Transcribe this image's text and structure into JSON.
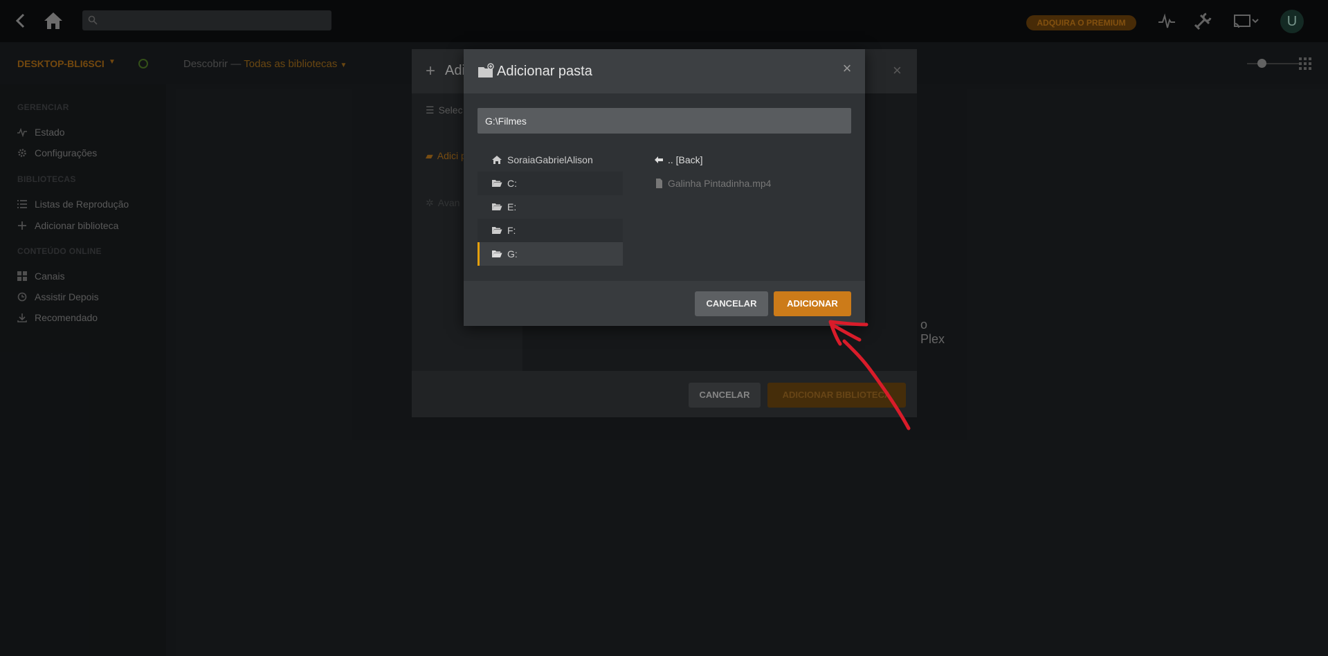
{
  "topbar": {
    "search_placeholder": "",
    "premium_label": "ADQUIRA O PREMIUM",
    "avatar_initial": "U"
  },
  "subbar": {
    "server_name": "DESKTOP-BLI6SCI",
    "crumb_prefix": "Descobrir",
    "crumb_separator": "—",
    "crumb_selected": "Todas as bibliotecas"
  },
  "sidebar": {
    "sections": [
      {
        "heading": "GERENCIAR",
        "items": [
          {
            "label": "Estado",
            "icon": "activity-icon"
          },
          {
            "label": "Configurações",
            "icon": "gear-icon"
          }
        ]
      },
      {
        "heading": "BIBLIOTECAS",
        "items": [
          {
            "label": "Listas de Reprodução",
            "icon": "list-icon"
          },
          {
            "label": "Adicionar biblioteca",
            "icon": "plus-icon"
          }
        ]
      },
      {
        "heading": "CONTEÚDO ONLINE",
        "items": [
          {
            "label": "Canais",
            "icon": "grid-icon"
          },
          {
            "label": "Assistir Depois",
            "icon": "clock-icon"
          },
          {
            "label": "Recomendado",
            "icon": "download-icon"
          }
        ]
      }
    ]
  },
  "bg_dialog": {
    "title": "Adic",
    "steps": [
      "Selec tipo",
      "Adici pastas",
      "Avan"
    ],
    "ghost_text": "o Plex",
    "cancel_label": "CANCELAR",
    "add_label": "ADICIONAR BIBLIOTECA"
  },
  "dialog": {
    "title": "Adicionar pasta",
    "path_value": "G:\\Filmes",
    "directories": [
      {
        "label": "SoraiaGabrielAlison",
        "icon": "home-icon"
      },
      {
        "label": "C:",
        "icon": "folder-open-icon"
      },
      {
        "label": "E:",
        "icon": "folder-open-icon"
      },
      {
        "label": "F:",
        "icon": "folder-open-icon"
      },
      {
        "label": "G:",
        "icon": "folder-open-icon"
      }
    ],
    "files": [
      {
        "label": ".. [Back]",
        "icon": "arrow-left-icon"
      },
      {
        "label": "Galinha Pintadinha.mp4",
        "icon": "file-icon"
      }
    ],
    "cancel_label": "CANCELAR",
    "add_label": "ADICIONAR"
  },
  "colors": {
    "accent": "#cc7b19",
    "selected_indicator": "#e5a00d",
    "annotation": "#d91c2a"
  }
}
